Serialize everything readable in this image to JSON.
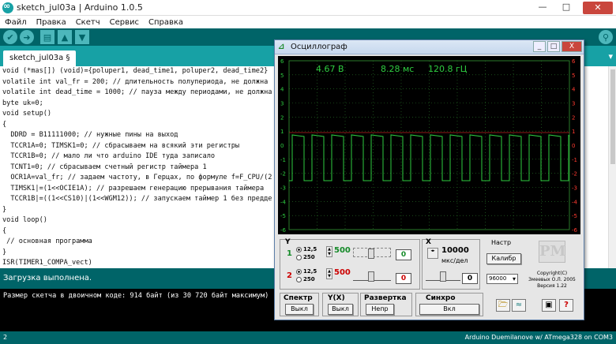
{
  "window": {
    "title": "sketch_jul03a | Arduino 1.0.5",
    "buttons": [
      "—",
      "□",
      "✕"
    ]
  },
  "menu": [
    "Файл",
    "Правка",
    "Скетч",
    "Сервис",
    "Справка"
  ],
  "toolbar": {
    "buttons": [
      {
        "name": "verify-button",
        "icon": "✔"
      },
      {
        "name": "upload-button",
        "icon": "➜"
      },
      {
        "name": "new-button",
        "icon": "▤"
      },
      {
        "name": "open-button",
        "icon": "▲"
      },
      {
        "name": "save-button",
        "icon": "▼"
      }
    ],
    "search_icon": "⚲"
  },
  "tab": {
    "label": "sketch_jul03a §",
    "menu_icon": "▾"
  },
  "code": [
    "void (*mas[]) (void)={poluper1, dead_time1, poluper2, dead_time2}",
    "volatile int val_fr = 200; // длительность полупериода, не должна",
    "volatile int dead_time = 1000; // пауза между периодами, не должна",
    "byte uk=0;",
    "void setup()",
    "{",
    "  DDRD = B11111000; // нужные пины на выход",
    "  TCCR1A=0; TIMSK1=0; // сбрасываем на всякий эти регистры",
    "  TCCR1B=0; // мало ли что arduino IDE туда записало",
    "  TCNT1=0; // сбрасываем счетный регистр таймера 1",
    "  OCR1A=val_fr; // задаем частоту, в Герцах, по формуле f=F_CPU/(2",
    "  TIMSK1|=(1<<OCIE1A); // разрешаем генерацию прерывания таймера",
    "  TCCR1B|=((1<<CS10)|(1<<WGM12)); // запускаем таймер 1 без предде",
    "}",
    "void loop()",
    "{",
    " // основная программа",
    "}",
    "ISR(TIMER1_COMPA_vect)"
  ],
  "status": "Загрузка выполнена.",
  "console": "Размер скетча в двоичном коде: 914 байт (из 30 720 байт максимум)",
  "footer": {
    "line": "2",
    "board": "Arduino Duemilanove w/ ATmega328 on COM3"
  },
  "oscilloscope": {
    "title": "Осциллограф",
    "win_buttons": [
      "_",
      "□",
      "X"
    ],
    "readings": {
      "voltage": "4.67 В",
      "period": "8.28 мс",
      "frequency": "120.8 гЦ"
    },
    "left_scale": [
      "6",
      "5",
      "4",
      "3",
      "2",
      "1",
      "0",
      "-1",
      "-2",
      "-3",
      "-4",
      "-5",
      "-6"
    ],
    "right_scale": [
      "6",
      "5",
      "4",
      "3",
      "2",
      "1",
      "0",
      "-1",
      "-2",
      "-3",
      "-4",
      "-5",
      "-6"
    ],
    "colors": {
      "trace": "#2ecc40",
      "grid": "#2a7a2a",
      "left_scale": "#2ecc40",
      "right_scale": "#ff3b30"
    },
    "y_group": {
      "label": "Y",
      "ch1": {
        "num": "1",
        "r1": "12,5",
        "r2": "250",
        "val": "500",
        "box": "0"
      },
      "ch2": {
        "num": "2",
        "r1": "12,5",
        "r2": "250",
        "val": "500",
        "box": "0"
      }
    },
    "x_group": {
      "label": "X",
      "val": "10000",
      "unit": "мкс/дел",
      "box": "0"
    },
    "settings": {
      "label": "Настр",
      "calib": "Калибр",
      "baud": "96000"
    },
    "copyright": {
      "logo": "PM",
      "l1": "Copyright(C)",
      "l2": "Змеевых О.Л. 2005",
      "l3": "Версия 1.22"
    },
    "spectrum": {
      "label": "Спектр",
      "btn": "Выкл"
    },
    "yx": {
      "label": "Y(X)",
      "btn": "Выкл"
    },
    "sweep": {
      "label": "Развертка",
      "btn": "Непр"
    },
    "sync": {
      "label": "Синхро",
      "btn": "Вкл"
    },
    "icons": {
      "open": "open-folder-icon",
      "wave": "wave-icon",
      "save": "floppy-icon",
      "help": "?"
    }
  }
}
